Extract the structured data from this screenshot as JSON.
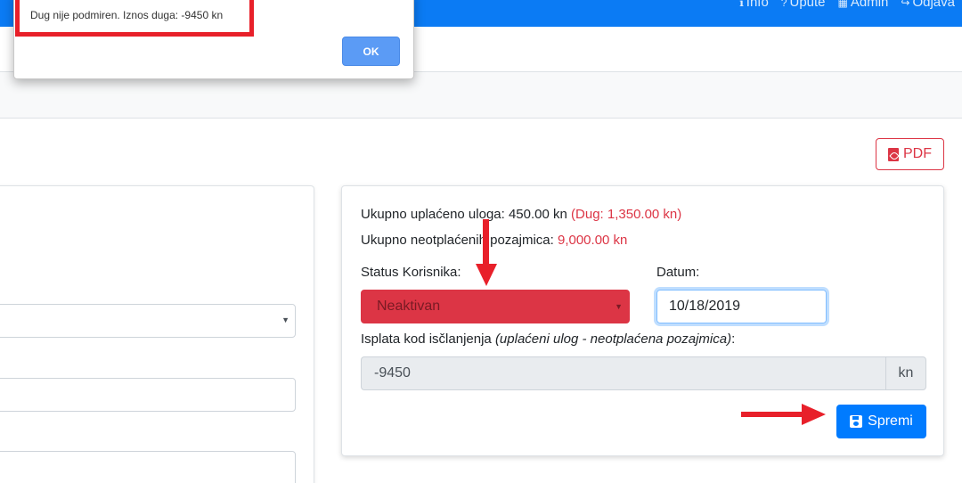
{
  "navbar": {
    "links": [
      {
        "label": "Info",
        "icon": "info-icon"
      },
      {
        "label": "Upute",
        "icon": "help-icon"
      },
      {
        "label": "Admin",
        "icon": "grid-icon"
      },
      {
        "label": "Odjava",
        "icon": "logout-icon"
      }
    ],
    "background": "#0b7bf4"
  },
  "pdf_button": {
    "label": "PDF",
    "icon": "file-pdf-icon"
  },
  "summary": {
    "deposit_label": "Ukupno uplaćeno uloga: 450.00 kn",
    "deposit_debt": "(Dug: 1,350.00 kn)",
    "loans_label": "Ukupno neotplaćenih pozajmica:",
    "loans_value": "9,000.00 kn"
  },
  "form": {
    "status_label": "Status Korisnika:",
    "status_value": "Neaktivan",
    "date_label": "Datum:",
    "date_value": "10/18/2019",
    "payout_label": "Isplata kod isčlanjenja",
    "payout_label_note": "(uplaćeni ulog - neotplaćena pozajmica)",
    "payout_label_suffix": ":",
    "payout_value": "-9450",
    "payout_unit": "kn",
    "save_label": "Spremi",
    "save_icon": "floppy-disk-icon"
  },
  "dialog": {
    "message": "Dug nije podmiren. Iznos duga: -9450 kn",
    "ok_label": "OK"
  },
  "colors": {
    "danger": "#dc3545",
    "primary": "#007bff",
    "annotation": "#e8202a"
  }
}
